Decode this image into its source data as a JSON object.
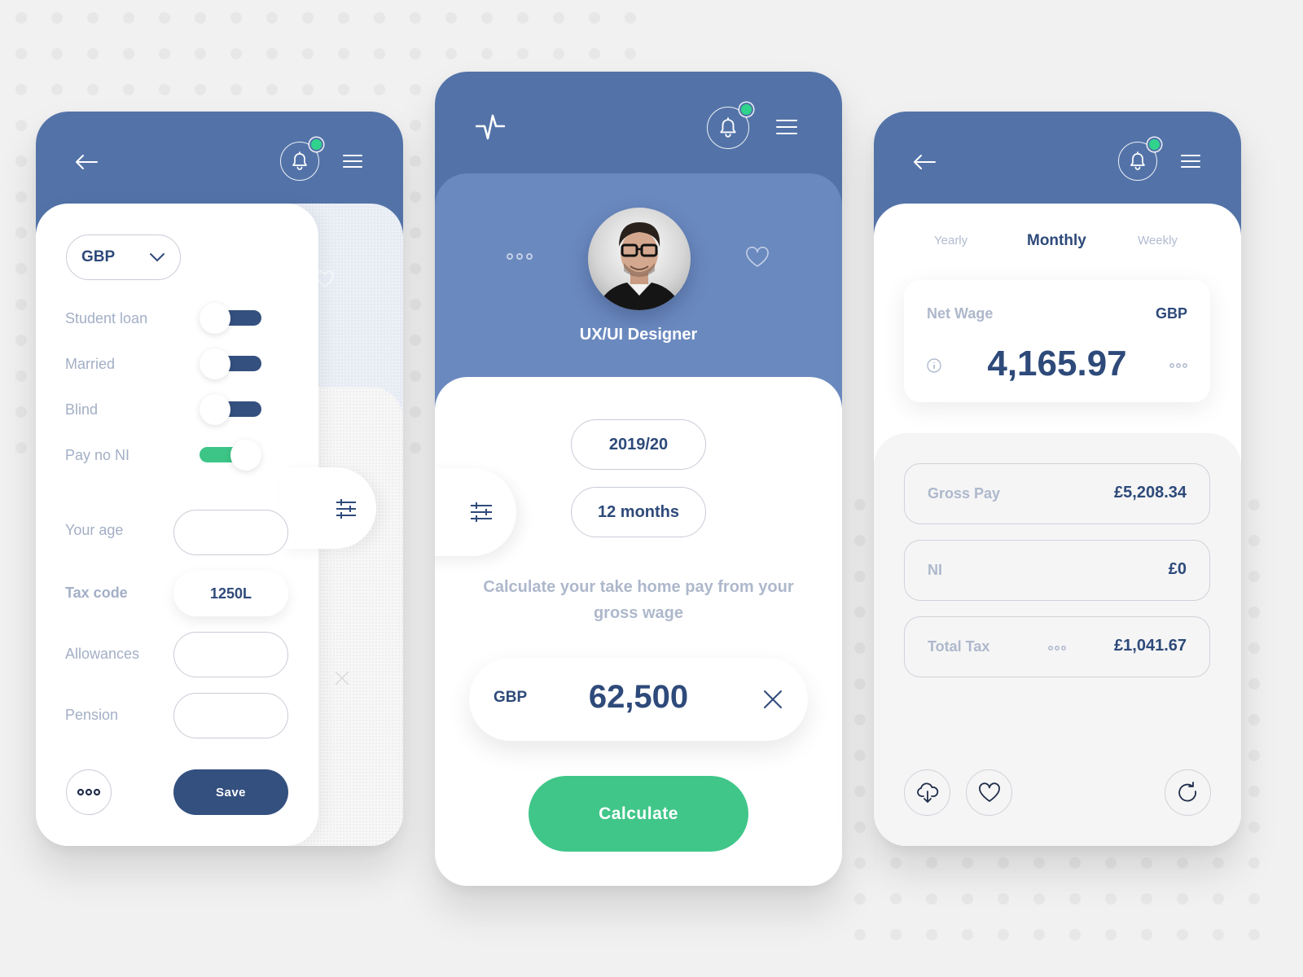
{
  "colors": {
    "header_blue": "#5373a8",
    "profile_blue": "#6a89bf",
    "navy": "#2e4a7a",
    "toggle_navy": "#34507f",
    "green": "#40c689",
    "notification_green": "#2fd38c",
    "muted_label": "#a3afc6",
    "background": "#f1f1f1"
  },
  "settings_screen": {
    "header": {
      "back_icon": "arrow-left-icon",
      "notification_icon": "bell-icon",
      "notification_badge": "green-dot",
      "menu_icon": "hamburger-icon"
    },
    "currency_select": {
      "value": "GBP",
      "icon": "chevron-down-icon"
    },
    "toggles": [
      {
        "label": "Student loan",
        "on": false
      },
      {
        "label": "Married",
        "on": false
      },
      {
        "label": "Blind",
        "on": false
      },
      {
        "label": "Pay no NI",
        "on": true
      }
    ],
    "fields": [
      {
        "label": "Your age",
        "value": ""
      },
      {
        "label": "Tax code",
        "value": "1250L"
      },
      {
        "label": "Allowances",
        "value": ""
      },
      {
        "label": "Pension",
        "value": ""
      }
    ],
    "filter_icon": "sliders-icon",
    "more_icon": "ellipsis-icon",
    "save_label": "Save"
  },
  "calculator_screen": {
    "header": {
      "logo_icon": "pulse-icon",
      "notification_icon": "bell-icon",
      "menu_icon": "hamburger-icon"
    },
    "profile": {
      "name": "UX/UI Designer",
      "more_icon": "ellipsis-icon",
      "favorite_icon": "heart-icon",
      "avatar_alt": "profile photo"
    },
    "tax_year": "2019/20",
    "period": "12 months",
    "filter_icon": "sliders-icon",
    "description": "Calculate your take home pay from your gross wage",
    "amount": {
      "currency": "GBP",
      "value": "62,500",
      "clear_icon": "close-icon"
    },
    "calculate_label": "Calculate"
  },
  "results_screen": {
    "header": {
      "back_icon": "arrow-left-icon",
      "notification_icon": "bell-icon",
      "menu_icon": "hamburger-icon"
    },
    "tabs": [
      {
        "label": "Yearly",
        "active": false
      },
      {
        "label": "Monthly",
        "active": true
      },
      {
        "label": "Weekly",
        "active": false
      }
    ],
    "net_wage": {
      "title": "Net Wage",
      "currency": "GBP",
      "value": "4,165.97"
    },
    "rows": [
      {
        "label": "Gross Pay",
        "value": "£5,208.34",
        "has_more": false
      },
      {
        "label": "NI",
        "value": "£0",
        "has_more": false
      },
      {
        "label": "Total Tax",
        "value": "£1,041.67",
        "has_more": true
      }
    ],
    "actions": [
      {
        "name": "download",
        "icon": "cloud-download-icon"
      },
      {
        "name": "favorite",
        "icon": "heart-icon"
      },
      {
        "name": "refresh",
        "icon": "refresh-icon"
      }
    ]
  }
}
